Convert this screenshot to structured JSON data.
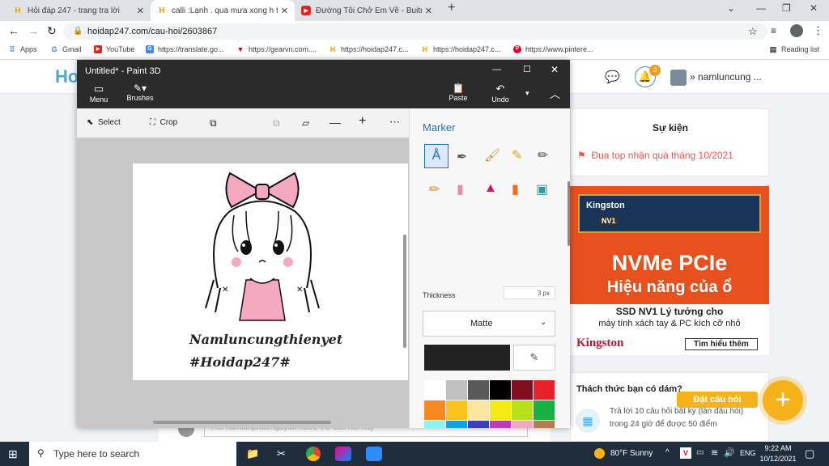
{
  "browser": {
    "tabs": [
      {
        "title": "Hỏi đáp 247 - trang tra lời",
        "icon": "H"
      },
      {
        "title": "calli :Lạnh . qua mưa xong h tạnh",
        "icon": "H"
      },
      {
        "title": "Đường Tôi Chở Em Về - Buitr",
        "icon": "▶"
      }
    ],
    "url": "hoidap247.com/cau-hoi/2603867",
    "bookmarks": [
      "Apps",
      "Gmail",
      "YouTube",
      "https://translate.go...",
      "https://gearvn.com....",
      "https://hoidap247.c...",
      "https://hoidap247.c...",
      "https://www.pintere..."
    ],
    "reading_list": "Reading list"
  },
  "site": {
    "notif_count": "3",
    "username": "namluncung ...",
    "events_title": "Sự kiện",
    "event_item": "Đua top nhận quà tháng 10/2021",
    "ad": {
      "brand": "Kingston",
      "headline": "NVMe PCIe",
      "subline": "Hiệu năng của ổ",
      "product": "SSD NV1 Lý tưởng cho",
      "product2": "máy tính xách tay & PC kích cỡ nhỏ",
      "cta": "Tìm hiểu thêm",
      "chip_label": "NV1"
    },
    "challenge_title": "Thách thức bạn có dám?",
    "challenge_text1": "Trả lời 10 câu hỏi  bất kỳ (lần đầu hỏi)",
    "challenge_text2": "trong 24 giờ để được 50 điểm",
    "ask_button": "Đặt câu hỏi",
    "comment_placeholder": "Hỏi namlunpnuengayan h001 VC cau hoi hay"
  },
  "paint": {
    "title": "Untitled* - Paint 3D",
    "menu": "Menu",
    "brushes": "Brushes",
    "paste": "Paste",
    "undo": "Undo",
    "select": "Select",
    "crop": "Crop",
    "panel_title": "Marker",
    "thickness_label": "Thickness",
    "thickness_value": "3 px",
    "finish": "Matte",
    "add_color": "Add color",
    "drawing_text1": "Namluncungthienyet",
    "drawing_text2": "#Hoidap247#",
    "current_color": "#222222",
    "palette": [
      "#ffffff",
      "#c0c0c0",
      "#595959",
      "#000000",
      "#7f0f1f",
      "#e8202a",
      "#f68a1e",
      "#f9c21c",
      "#fae6a0",
      "#f5ea14",
      "#b7e21b",
      "#1bb142",
      "#8df2f2",
      "#0fa0e8",
      "#3d3fbf",
      "#b93ebb",
      "#f2a6c8",
      "#b57b52"
    ]
  },
  "taskbar": {
    "search_placeholder": "Type here to search",
    "weather": "80°F  Sunny",
    "lang": "ENG",
    "time": "9:22 AM",
    "date": "10/12/2021"
  }
}
